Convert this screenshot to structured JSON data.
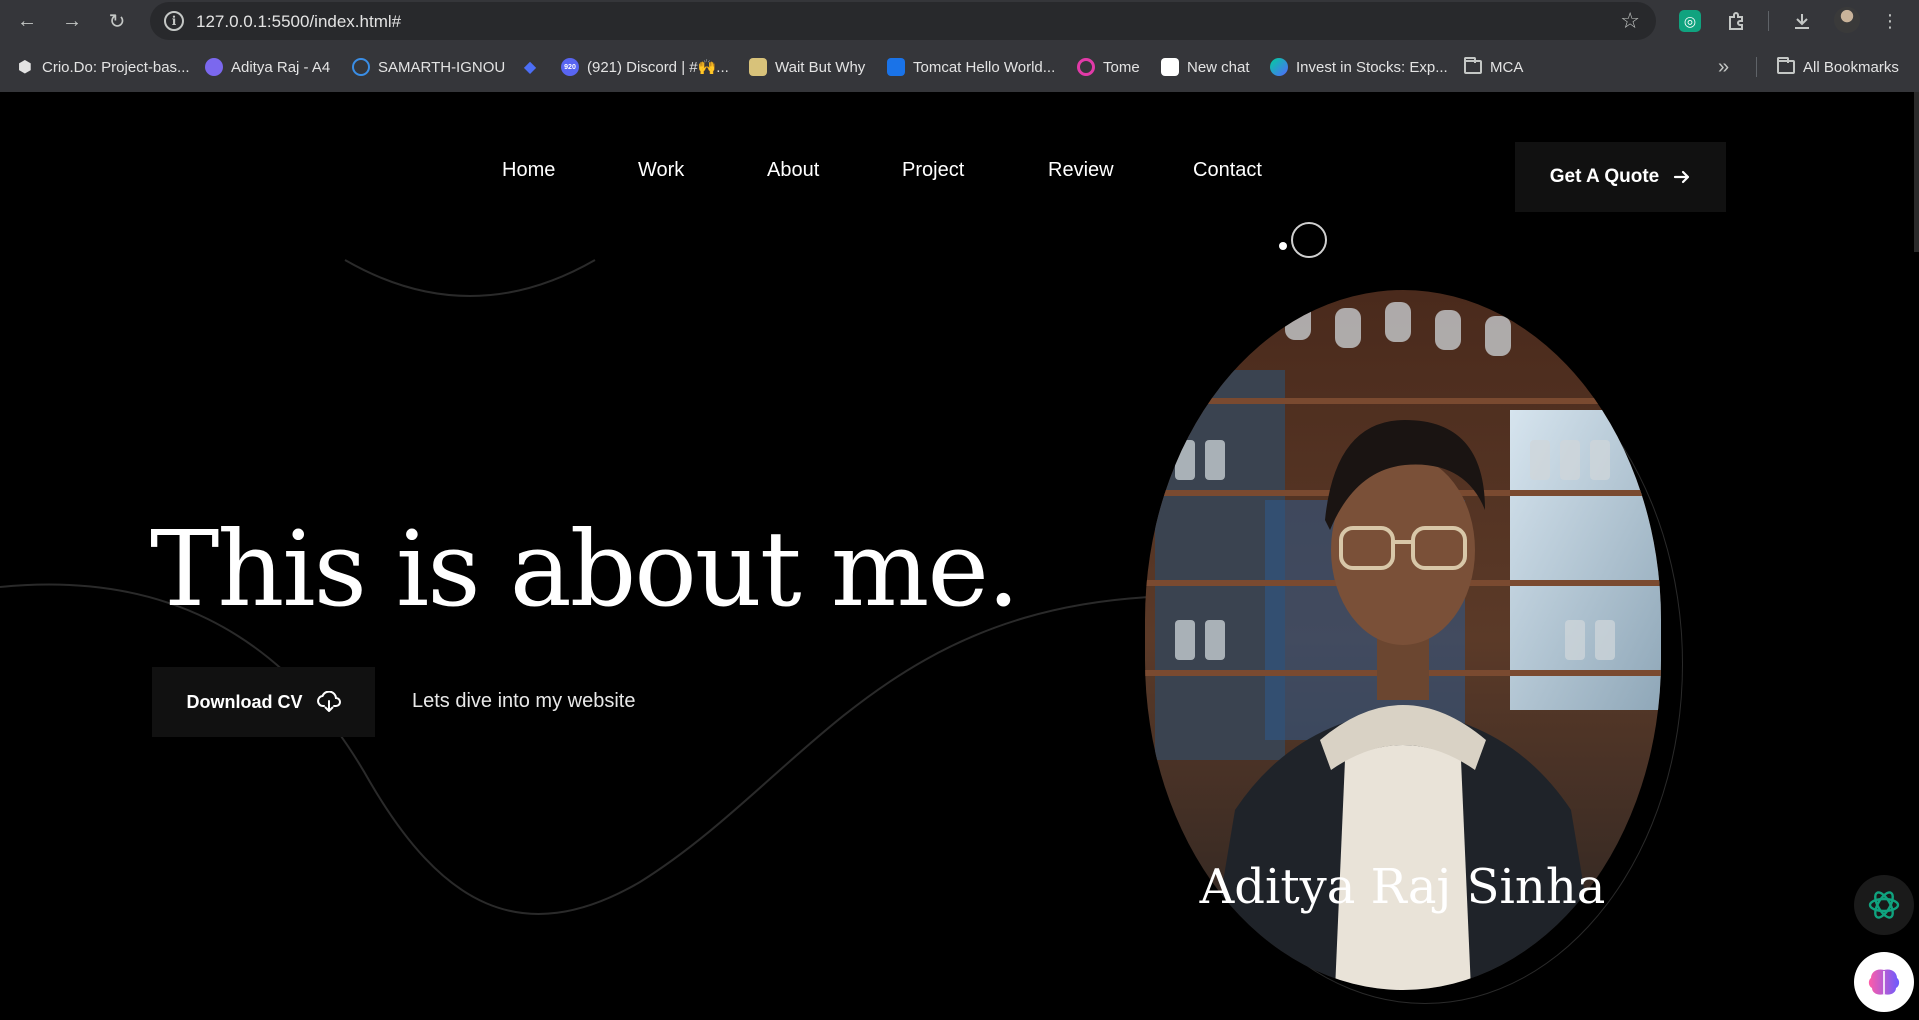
{
  "browser": {
    "url": "127.0.0.1:5500/index.html#",
    "nav": {
      "back": "←",
      "forward": "→",
      "reload": "↻"
    },
    "bookmarks": [
      {
        "label": "Crio.Do: Project-bas...",
        "icon": "crio-icon",
        "color": "#e3e3e3",
        "glyph": "⬢"
      },
      {
        "label": "Aditya Raj - A4",
        "icon": "doc-icon",
        "color": "#7b68ee",
        "glyph": ""
      },
      {
        "label": "SAMARTH-IGNOU",
        "icon": "samarth-icon",
        "color": "#3a8ee6",
        "glyph": ""
      },
      {
        "label": "",
        "icon": "diamond-icon",
        "color": "#4c6ef5",
        "glyph": "◆"
      },
      {
        "label": "(921) Discord | #🙌...",
        "icon": "discord-icon",
        "color": "#5865f2",
        "glyph": "920"
      },
      {
        "label": "Wait But Why",
        "icon": "waitbutwhy-icon",
        "color": "#d8c27a",
        "glyph": ""
      },
      {
        "label": "Tomcat Hello World...",
        "icon": "tomcat-icon",
        "color": "#1a73e8",
        "glyph": ""
      },
      {
        "label": "Tome",
        "icon": "tome-icon",
        "color": "#e23aa8",
        "glyph": ""
      },
      {
        "label": "New chat",
        "icon": "openai-icon",
        "color": "#ffffff",
        "glyph": ""
      },
      {
        "label": "Invest in Stocks: Exp...",
        "icon": "groww-icon",
        "color": "#00d09c",
        "glyph": ""
      },
      {
        "label": "MCA",
        "icon": "folder-icon",
        "color": "",
        "glyph": ""
      }
    ],
    "more_bookmarks": "»",
    "all_bookmarks": "All Bookmarks"
  },
  "nav": {
    "links": [
      "Home",
      "Work",
      "About",
      "Project",
      "Review",
      "Contact"
    ],
    "quote_button": "Get A Quote"
  },
  "hero": {
    "title": "This is about me.",
    "cv_button": "Download CV",
    "tagline": "Lets dive into my website"
  },
  "profile": {
    "name": "Aditya Raj Sinha"
  },
  "colors": {
    "background": "#000000",
    "button_bg": "#111111",
    "chrome_bg": "#35363a"
  }
}
